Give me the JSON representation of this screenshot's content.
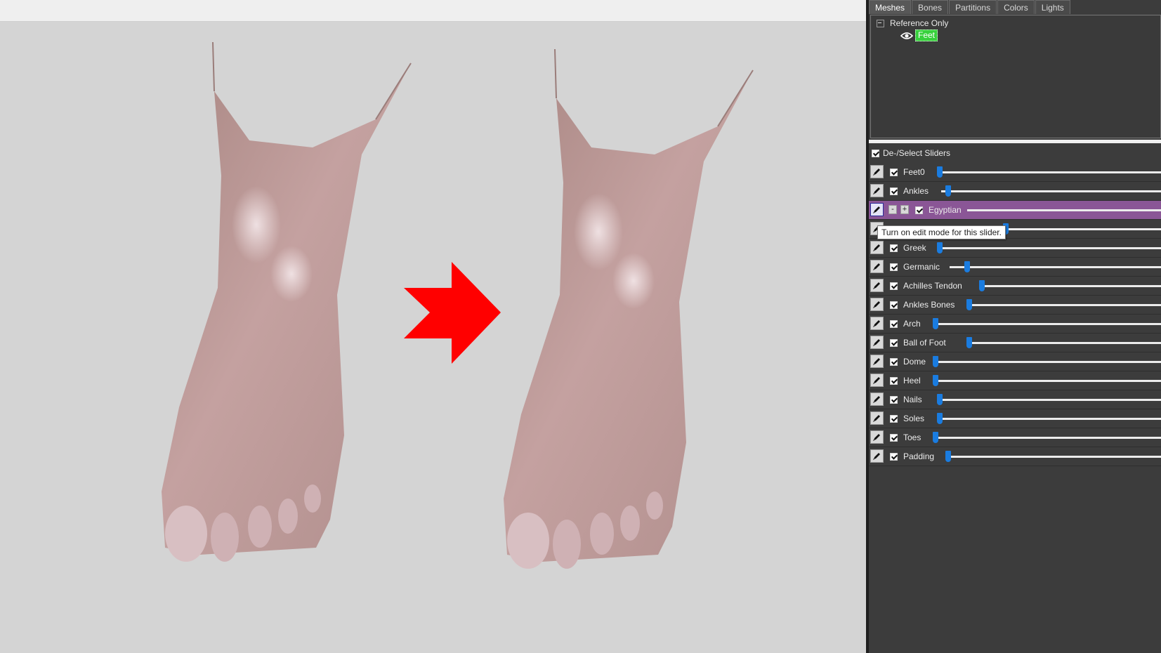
{
  "viewport": {
    "background": "#d4d4d4",
    "arrow_color": "#ff0000"
  },
  "tabs": [
    {
      "label": "Meshes",
      "active": true
    },
    {
      "label": "Bones"
    },
    {
      "label": "Partitions"
    },
    {
      "label": "Colors"
    },
    {
      "label": "Lights"
    }
  ],
  "tree": {
    "root_label": "Reference Only",
    "child_label": "Feet",
    "child_highlight": "#37d13c"
  },
  "sliders_header": {
    "label": "De-/Select Sliders",
    "checked": true
  },
  "tooltip": "Turn on edit mode for this slider.",
  "sliders": [
    {
      "label": "Feet0",
      "value": 0
    },
    {
      "label": "Ankles",
      "value": 0.02
    },
    {
      "label": "Egyptian",
      "value": 0,
      "selected": true
    },
    {
      "label": "",
      "value": 0.03,
      "covered": true
    },
    {
      "label": "Greek",
      "value": 0
    },
    {
      "label": "Germanic",
      "value": 0.07
    },
    {
      "label": "Achilles Tendon",
      "value": 0
    },
    {
      "label": "Ankles Bones",
      "value": 0
    },
    {
      "label": "Arch",
      "value": 0
    },
    {
      "label": "Ball of Foot",
      "value": 0
    },
    {
      "label": "Dome",
      "value": 0
    },
    {
      "label": "Heel",
      "value": 0
    },
    {
      "label": "Nails",
      "value": 0
    },
    {
      "label": "Soles",
      "value": 0
    },
    {
      "label": "Toes",
      "value": 0
    },
    {
      "label": "Padding",
      "value": 0
    }
  ],
  "selected_controls": {
    "minus": "-",
    "plus": "+"
  },
  "slider_thumb_color": "#1a7ce0"
}
